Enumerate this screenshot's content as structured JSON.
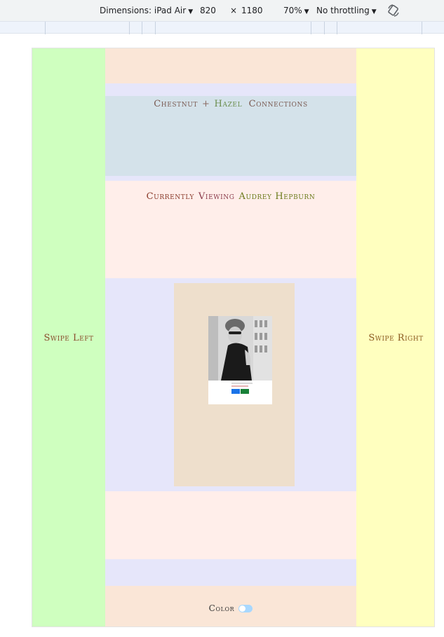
{
  "devtools": {
    "dimensions_label": "Dimensions: iPad Air",
    "width": "820",
    "times": "×",
    "height": "1180",
    "zoom": "70%",
    "throttling": "No throttling",
    "caret": "▼"
  },
  "page": {
    "swipe_left": "Swipe Left",
    "swipe_right": "Swipe Right",
    "title": {
      "part1": "Chestnut",
      "plus": "+",
      "part2": "Hazel",
      "part3": "Connections"
    },
    "viewing": {
      "label": "Currently",
      "verb": "Viewing",
      "name": "Audrey Hepburn"
    },
    "color_toggle_label": "Color",
    "color_toggle_on": false
  },
  "colors": {
    "left_panel": "#cfffbf",
    "right_panel": "#ffffbf",
    "header_band": "#fae6d7",
    "lavender": "#e6e6fa",
    "title_band": "#d4e2ea",
    "pink_band": "#ffeeea",
    "card_bg": "#eedfcc",
    "toggle": "#a8d8ff"
  }
}
